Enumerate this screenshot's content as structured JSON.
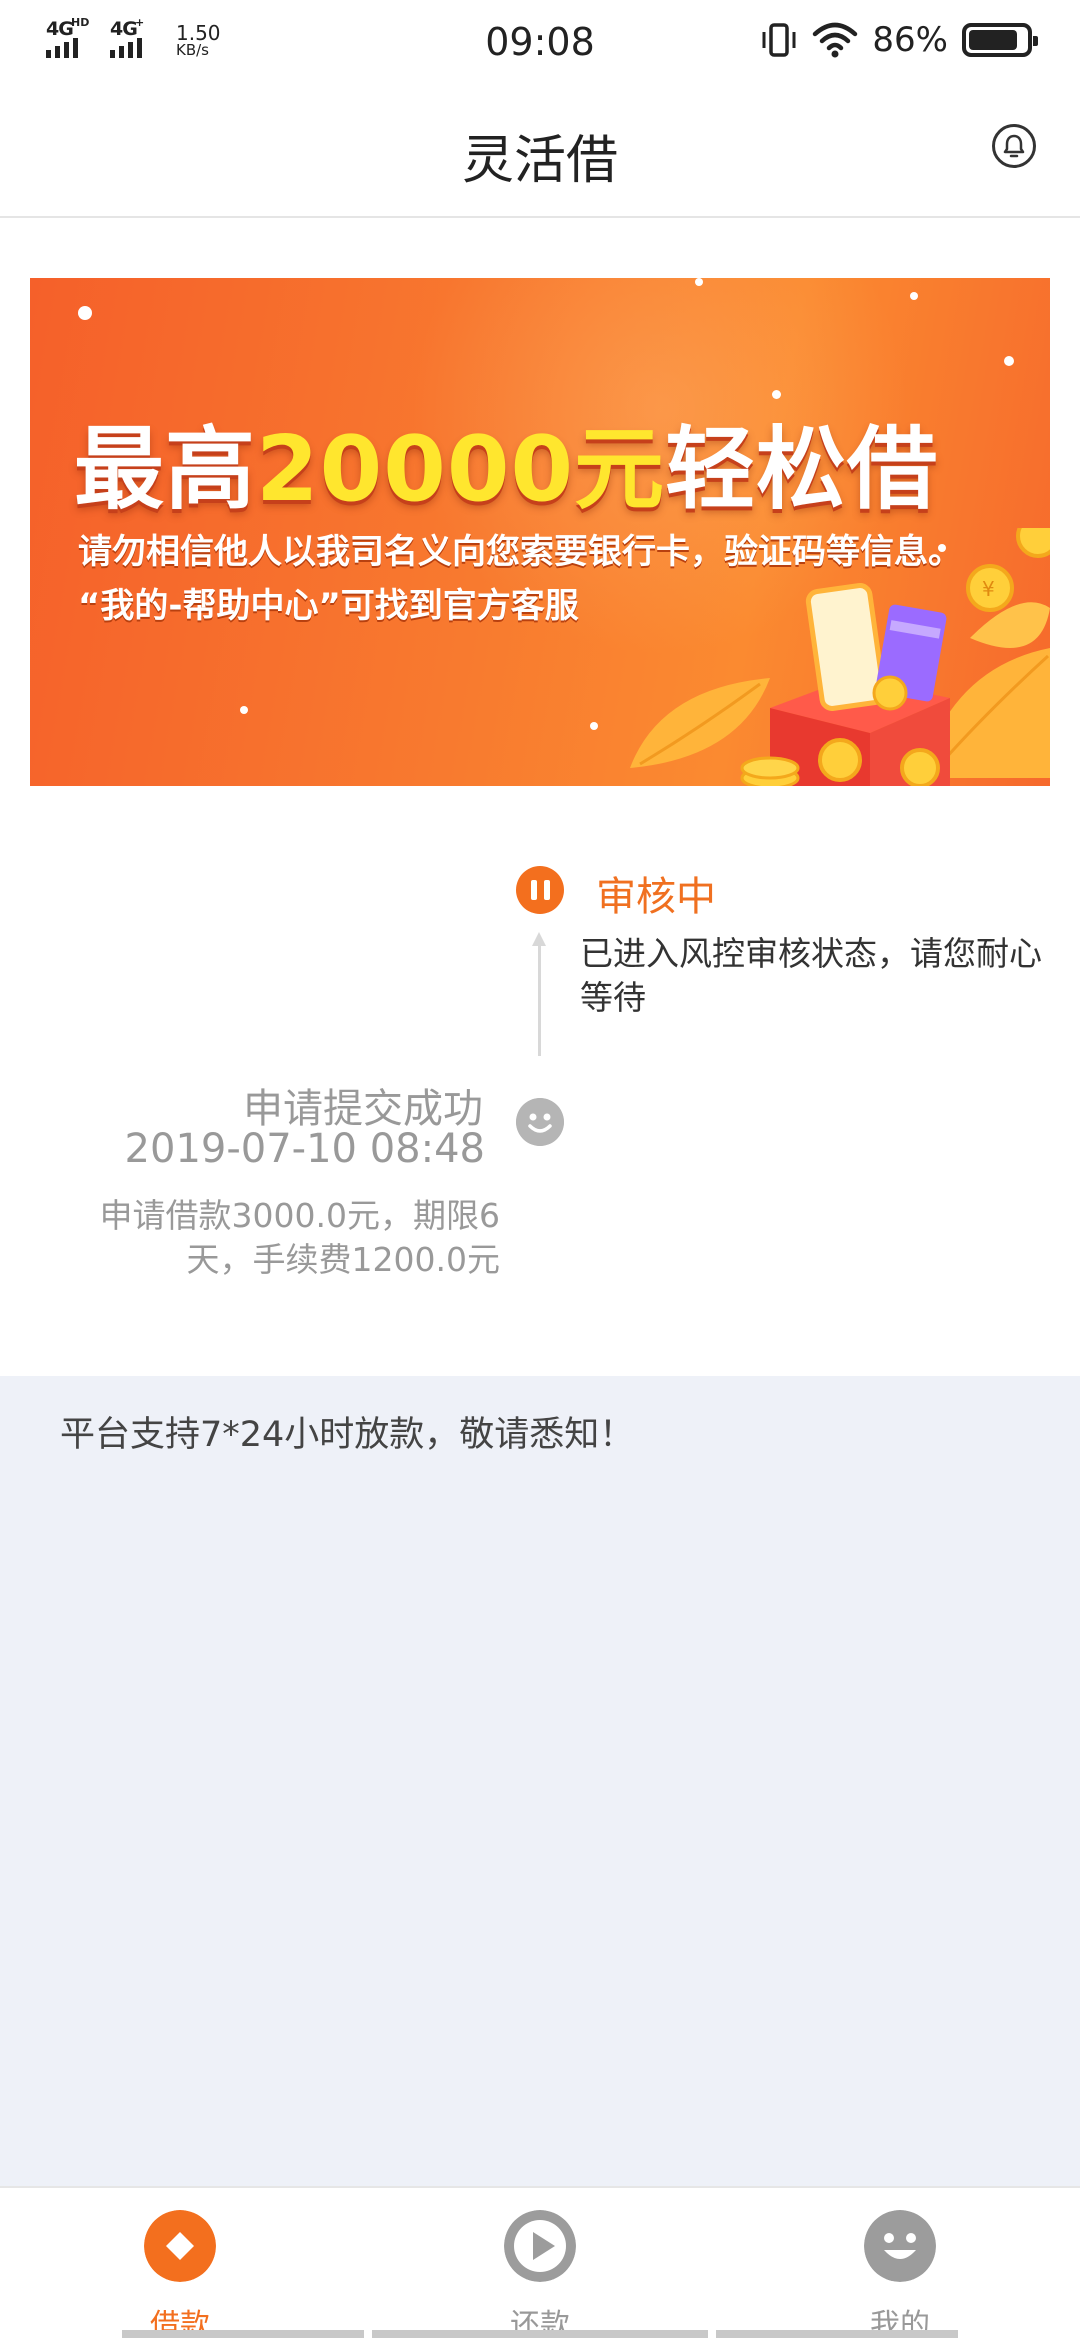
{
  "status_bar": {
    "network_1": "4G",
    "network_1_sup": "HD",
    "network_2": "4G",
    "network_2_sup": "+",
    "speed_value": "1.50",
    "speed_unit": "KB/s",
    "time": "09:08",
    "battery_percent": "86%",
    "battery_level": 0.86
  },
  "header": {
    "title": "灵活借",
    "bell_icon": "bell-icon"
  },
  "banner": {
    "headline_prefix": "最高",
    "headline_amount": "20000元",
    "headline_suffix": "轻松借",
    "line_1": "请勿相信他人以我司名义向您索要银行卡，验证码等信息。",
    "line_2": "“我的-帮助中心”可找到官方客服",
    "colors": {
      "background": "#f5602a",
      "highlight": "#ffe62e"
    }
  },
  "timeline": {
    "current": {
      "title": "审核中",
      "description": "已进入风控审核状态，请您耐心等待",
      "icon": "pause-icon"
    },
    "submitted": {
      "title": "申请提交成功",
      "time": "2019-07-10 08:48",
      "description": "申请借款3000.0元，期限6天，手续费1200.0元",
      "icon": "smile-icon"
    }
  },
  "notice": {
    "text": "平台支持7*24小时放款，敬请悉知！"
  },
  "bottom_nav": {
    "items": [
      {
        "label": "借款",
        "icon": "diamond-icon",
        "active": true
      },
      {
        "label": "还款",
        "icon": "play-icon",
        "active": false
      },
      {
        "label": "我的",
        "icon": "smile-icon",
        "active": false
      }
    ],
    "colors": {
      "active": "#f36f1e",
      "inactive": "#999999"
    }
  }
}
